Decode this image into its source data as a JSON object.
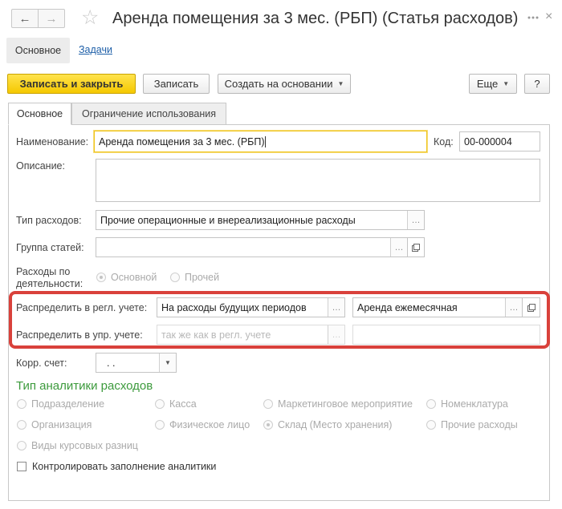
{
  "window": {
    "title": "Аренда помещения за 3 мес. (РБП) (Статья расходов)"
  },
  "nav": {
    "back_icon": "←",
    "forward_icon": "→",
    "star_icon": "☆"
  },
  "section_tabs": {
    "main": "Основное",
    "tasks": "Задачи"
  },
  "toolbar": {
    "save_close": "Записать и закрыть",
    "save": "Записать",
    "create_based": "Создать на основании",
    "more": "Еще",
    "help": "?"
  },
  "form_tabs": {
    "main": "Основное",
    "restrictions": "Ограничение использования"
  },
  "fields": {
    "name_label": "Наименование:",
    "name_value": "Аренда помещения за 3 мес. (РБП)",
    "code_label": "Код:",
    "code_value": "00-000004",
    "description_label": "Описание:",
    "expense_type_label": "Тип расходов:",
    "expense_type_value": "Прочие операционные и внереализационные расходы",
    "group_label": "Группа статей:",
    "activity_label_1": "Расходы по",
    "activity_label_2": "деятельности:",
    "activity_main": "Основной",
    "activity_other": "Прочей",
    "distribute_reg_label": "Распределить в регл. учете:",
    "distribute_reg_value": "На расходы будущих периодов",
    "distribute_reg_detail": "Аренда ежемесячная",
    "distribute_mgmt_label": "Распределить в упр. учете:",
    "distribute_mgmt_placeholder": "так же как в регл. учете",
    "corr_account_label": "Корр. счет:",
    "corr_account_value": ". ."
  },
  "analytics": {
    "title": "Тип аналитики расходов",
    "options": [
      [
        "Подразделение",
        "Касса",
        "Маркетинговое мероприятие",
        "Номенклатура"
      ],
      [
        "Организация",
        "Физическое лицо",
        "Склад (Место хранения)",
        "Прочие расходы"
      ],
      [
        "Виды курсовых разниц"
      ]
    ],
    "selected": "Склад (Место хранения)",
    "control_checkbox": "Контролировать заполнение аналитики"
  },
  "colors": {
    "primary": "#f5c800",
    "highlight_border": "#d9413b",
    "analytics_title": "#3c9a3c"
  }
}
